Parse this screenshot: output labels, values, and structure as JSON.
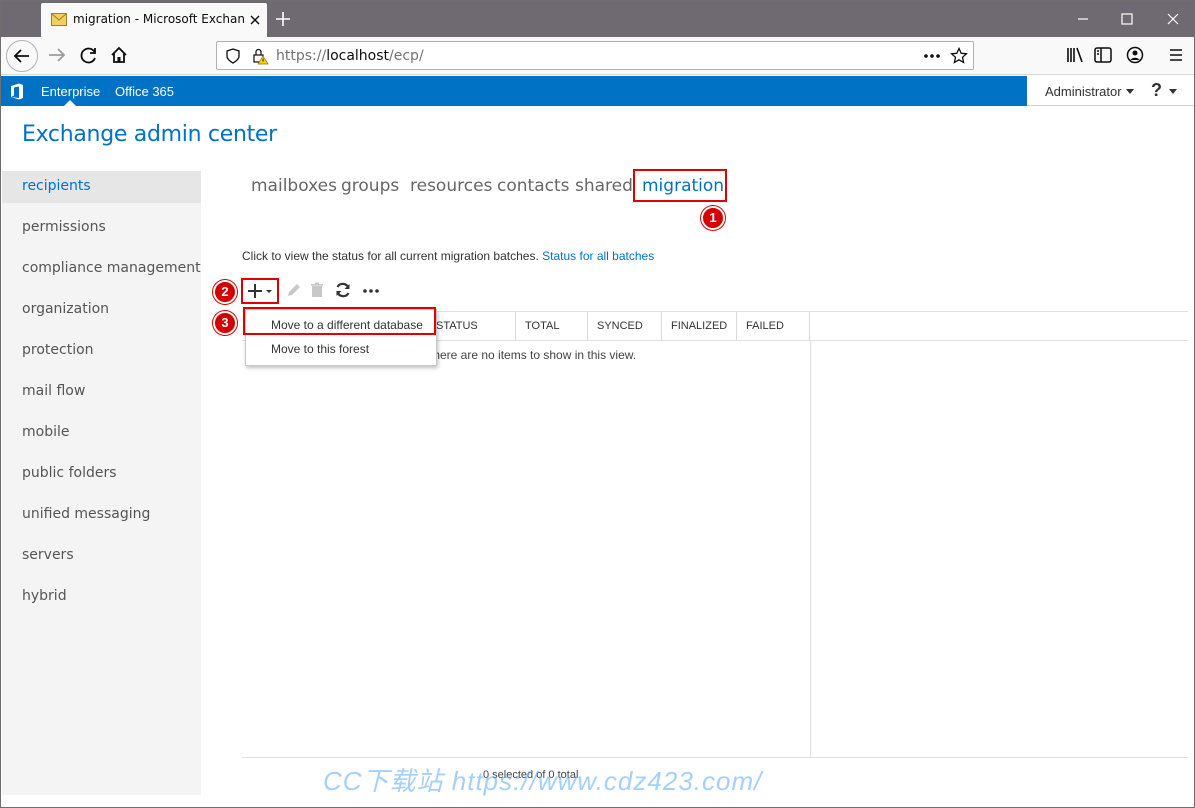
{
  "browser": {
    "tab_title": "migration - Microsoft Exchange",
    "url_prefix": "https://",
    "url_host": "localhost",
    "url_path": "/ecp/"
  },
  "suitebar": {
    "enterprise": "Enterprise",
    "office365": "Office 365",
    "user": "Administrator",
    "help": "?"
  },
  "app": {
    "title": "Exchange admin center"
  },
  "leftnav": {
    "items": [
      "recipients",
      "permissions",
      "compliance management",
      "organization",
      "protection",
      "mail flow",
      "mobile",
      "public folders",
      "unified messaging",
      "servers",
      "hybrid"
    ]
  },
  "subtabs": [
    "mailboxes",
    "groups",
    "resources",
    "contacts",
    "shared",
    "migration"
  ],
  "status": {
    "text": "Click to view the status for all current migration batches.",
    "link": "Status for all batches"
  },
  "grid": {
    "columns": [
      "STATUS",
      "TOTAL",
      "SYNCED",
      "FINALIZED",
      "FAILED"
    ],
    "empty_message": "There are no items to show in this view.",
    "footer": "0 selected of 0 total"
  },
  "menu": {
    "items": [
      "Move to a different database",
      "Move to this forest"
    ]
  },
  "callouts": [
    "1",
    "2",
    "3"
  ],
  "watermark": "CC下载站  https://www.cdz423.com/",
  "colors": {
    "accent": "#0072c6",
    "callout": "#d40000"
  }
}
